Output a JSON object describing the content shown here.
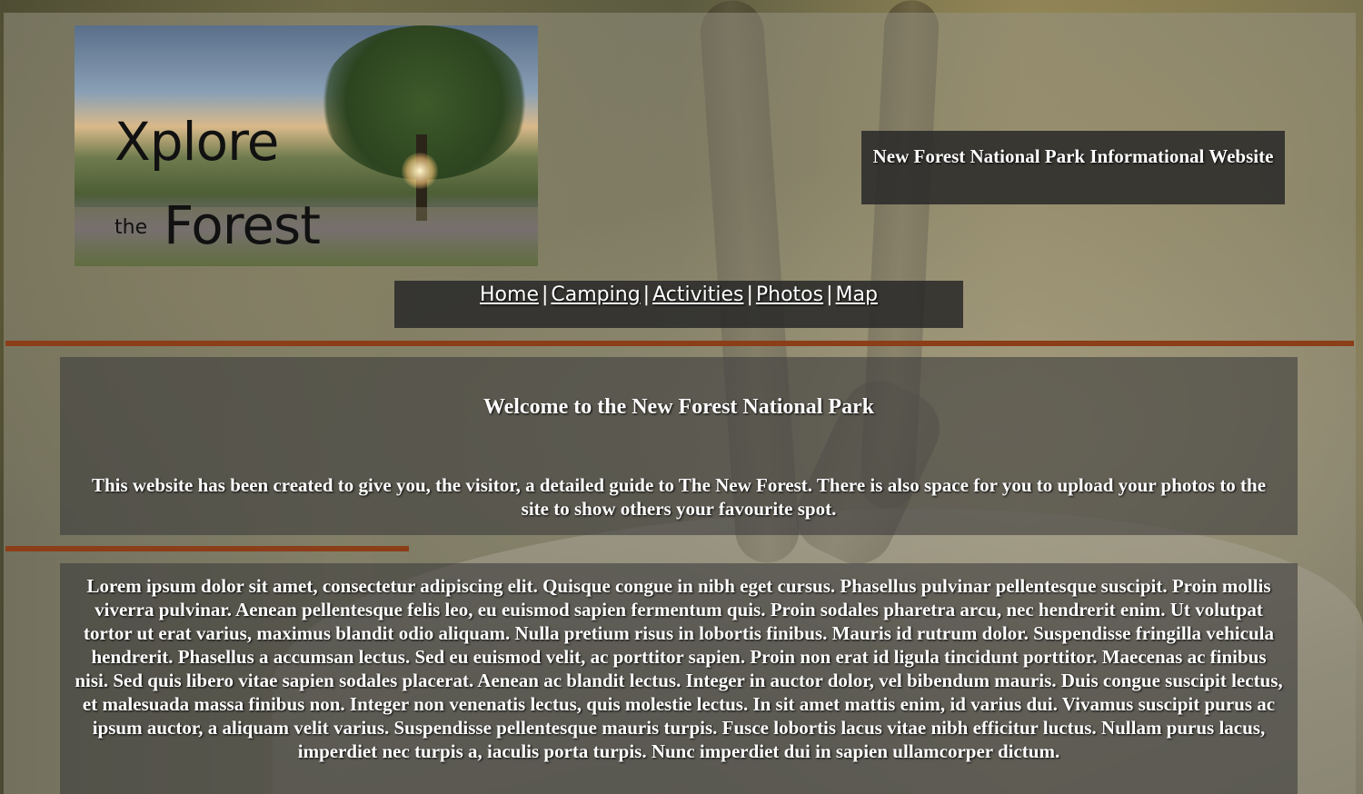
{
  "logo": {
    "line1": "Xplore",
    "the": "the",
    "line2": "Forest"
  },
  "tagline": "New Forest National Park Informational Website",
  "nav": {
    "items": [
      {
        "label": "Home"
      },
      {
        "label": "Camping"
      },
      {
        "label": "Activities"
      },
      {
        "label": "Photos"
      },
      {
        "label": "Map"
      }
    ],
    "separator": "|"
  },
  "welcome": {
    "heading": "Welcome to the New Forest National Park",
    "intro": "This website has been created to give you, the visitor, a detailed guide to The New Forest. There is also space for you to upload your photos to the site to show others your favourite spot."
  },
  "body_text": "Lorem ipsum dolor sit amet, consectetur adipiscing elit. Quisque congue in nibh eget cursus. Phasellus pulvinar pellentesque suscipit. Proin mollis viverra pulvinar. Aenean pellentesque felis leo, eu euismod sapien fermentum quis. Proin sodales pharetra arcu, nec hendrerit enim. Ut volutpat tortor ut erat varius, maximus blandit odio aliquam. Nulla pretium risus in lobortis finibus. Mauris id rutrum dolor. Suspendisse fringilla vehicula hendrerit. Phasellus a accumsan lectus. Sed eu euismod velit, ac porttitor sapien. Proin non erat id ligula tincidunt porttitor. Maecenas ac finibus nisi. Sed quis libero vitae sapien sodales placerat. Aenean ac blandit lectus. Integer in auctor dolor, vel bibendum mauris. Duis congue suscipit lectus, et malesuada massa finibus non. Integer non venenatis lectus, quis molestie lectus. In sit amet mattis enim, id varius dui. Vivamus suscipit purus ac ipsum auctor, a aliquam velit varius. Suspendisse pellentesque mauris turpis. Fusce lobortis lacus vitae nibh efficitur luctus. Nullam purus lacus, imperdiet nec turpis a, iaculis porta turpis. Nunc imperdiet dui in sapien ullamcorper dictum.",
  "colors": {
    "accent_rule": "#8b3e18",
    "box_text": "#ffffff"
  }
}
